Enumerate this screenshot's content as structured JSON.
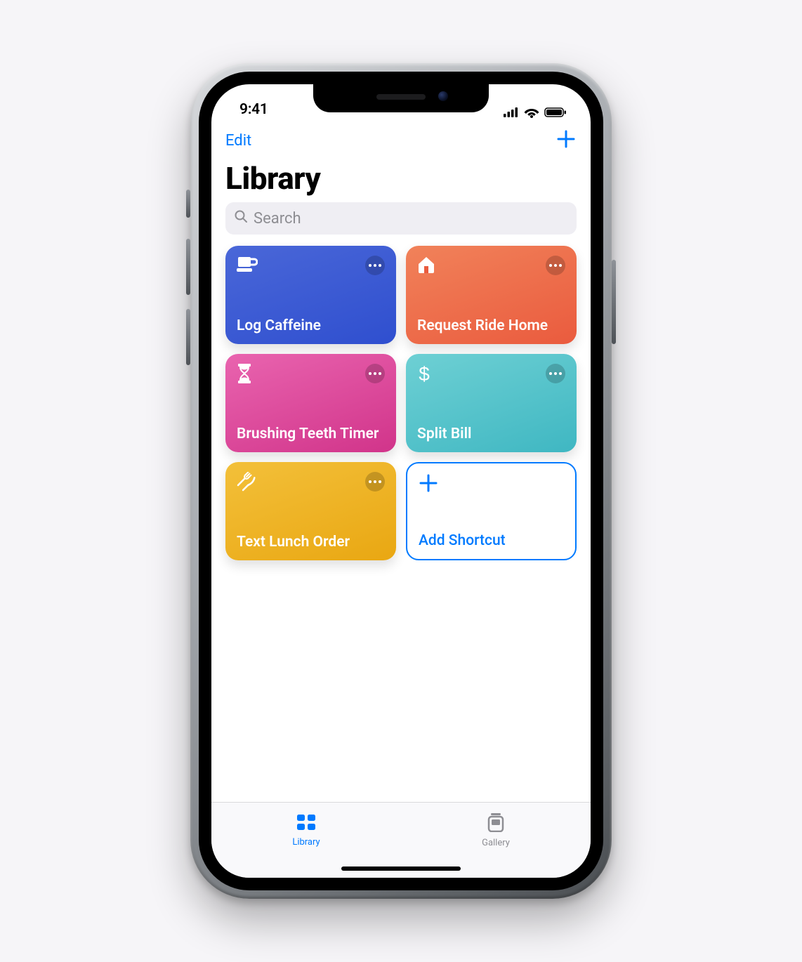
{
  "status": {
    "time": "9:41"
  },
  "nav": {
    "edit": "Edit"
  },
  "title": "Library",
  "search": {
    "placeholder": "Search"
  },
  "shortcuts": [
    {
      "label": "Log Caffeine",
      "icon": "cup-icon",
      "color": "blue"
    },
    {
      "label": "Request Ride Home",
      "icon": "home-icon",
      "color": "orange"
    },
    {
      "label": "Brushing Teeth Timer",
      "icon": "hourglass-icon",
      "color": "pink"
    },
    {
      "label": "Split Bill",
      "icon": "dollar-icon",
      "color": "teal"
    },
    {
      "label": "Text Lunch Order",
      "icon": "utensils-icon",
      "color": "yellow"
    }
  ],
  "add_card": {
    "label": "Add Shortcut"
  },
  "tabs": {
    "library": "Library",
    "gallery": "Gallery"
  }
}
